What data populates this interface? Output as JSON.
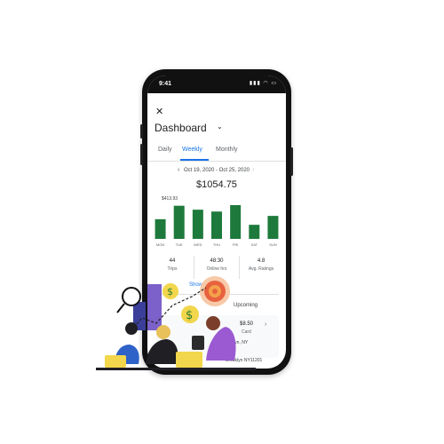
{
  "status_bar": {
    "time": "9:41",
    "icons": "▮▮▮ ◠ ▭"
  },
  "header": {
    "close_icon": "close-icon",
    "title": "Dashboard",
    "dropdown_icon": "chevron-down-icon"
  },
  "tabs": [
    {
      "label": "Daily",
      "active": false
    },
    {
      "label": "Weekly",
      "active": true
    },
    {
      "label": "Monthly",
      "active": false
    }
  ],
  "date_range": {
    "label": "Oct 19, 2020 - Oct 25, 2020"
  },
  "total": "$1054.75",
  "chart_data": {
    "type": "bar",
    "categories": [
      "MON",
      "TUE",
      "WED",
      "THU",
      "FRI",
      "SAT",
      "SUN"
    ],
    "values": [
      95,
      160,
      141,
      132,
      163,
      68,
      111
    ],
    "highlight_label": "$413.93",
    "colors": {
      "bar": "#1e7a3c"
    }
  },
  "stats": [
    {
      "value": "44",
      "label": "Trips"
    },
    {
      "value": "48:30",
      "label": "Online hrs"
    },
    {
      "value": "4.8",
      "label": "Avg. Ratings"
    }
  ],
  "details_link": "Show details",
  "upcoming_label": "Upcoming",
  "trip": {
    "fare": "$8.50",
    "payment": "Card",
    "address_1": "Brooklyn, NY",
    "address_2": "Brooklyn NY11201"
  },
  "colors": {
    "accent": "#1a73e8",
    "bar": "#1e7a3c",
    "phone": "#111111"
  }
}
